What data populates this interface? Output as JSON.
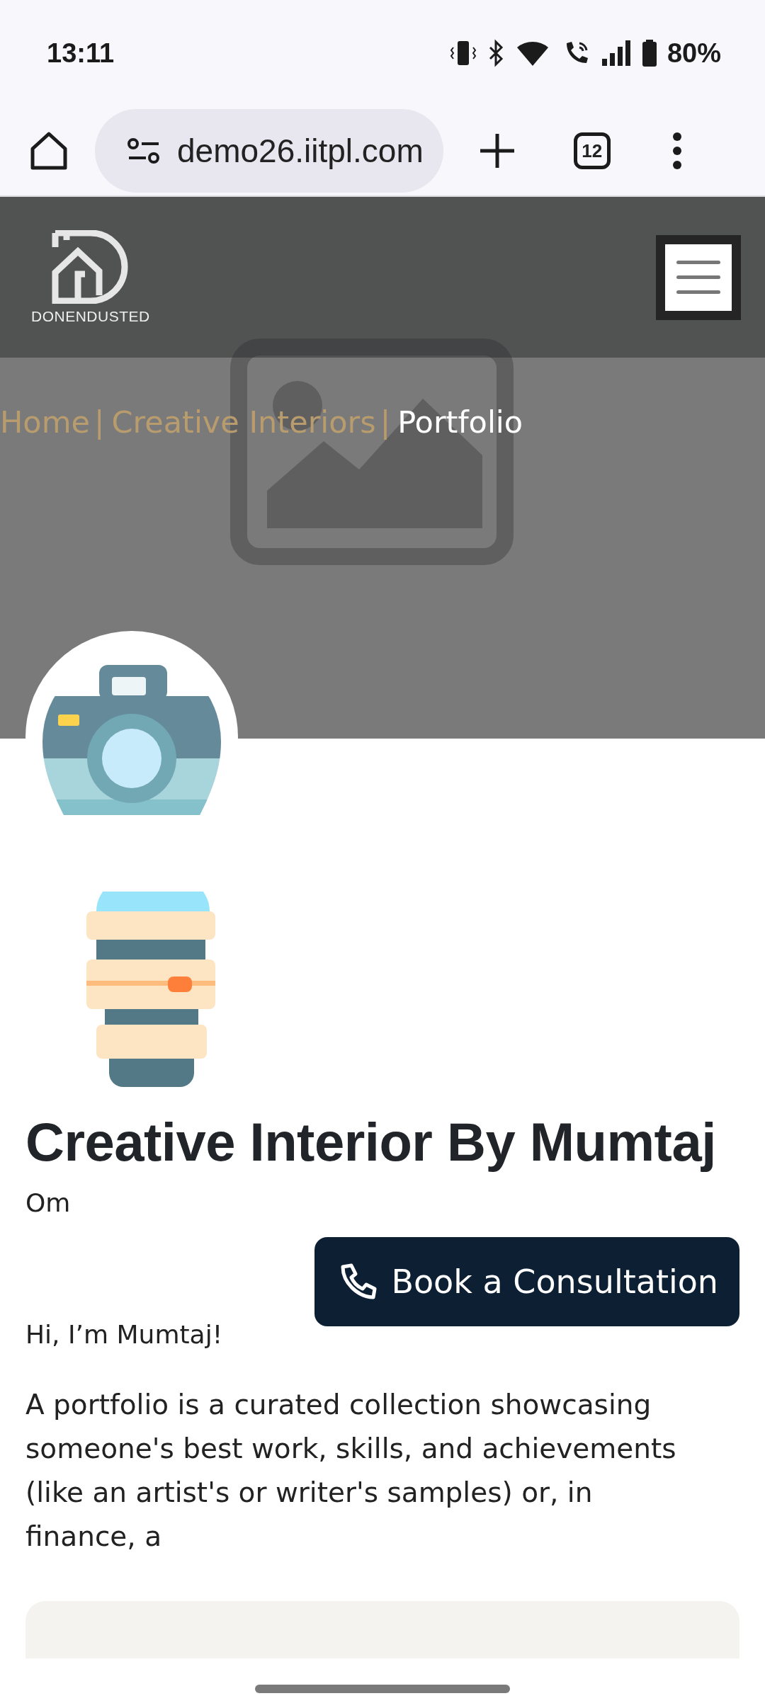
{
  "status_bar": {
    "time": "13:11",
    "battery": "80%"
  },
  "browser": {
    "url": "demo26.iitpl.com",
    "tab_count": "12"
  },
  "site_header": {
    "logo_text": "DONENDUSTED"
  },
  "breadcrumb": [
    {
      "label": "Home",
      "separator": "|",
      "current": false
    },
    {
      "label": "Creative Interiors",
      "separator": "|",
      "current": false
    },
    {
      "label": "Portfolio",
      "current": true
    }
  ],
  "profile": {
    "title": "Creative Interior By Mumtaj",
    "subtitle": "Om",
    "button": "Book a Consultation",
    "greeting": "Hi, I’m Mumtaj!",
    "bio": "A portfolio is a curated collection showcasing someone's best work, skills, and achievements (like an artist's or writer's samples) or, in finance, a"
  }
}
